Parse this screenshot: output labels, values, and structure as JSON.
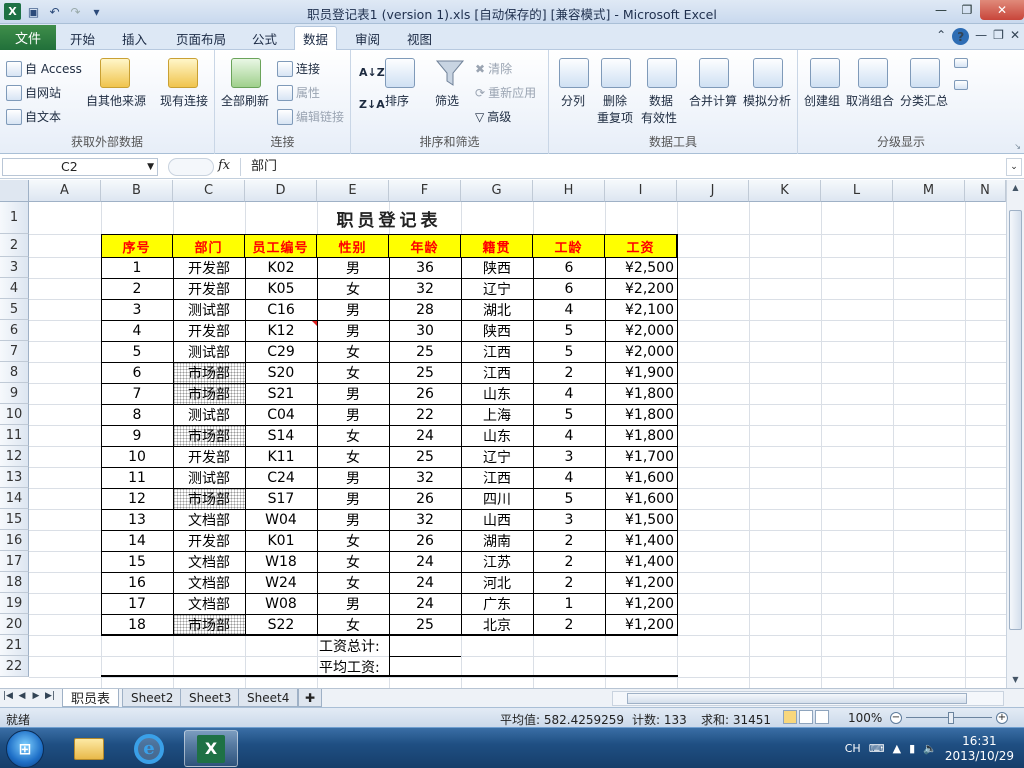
{
  "window": {
    "title": "职员登记表1 (version 1).xls [自动保存的]  [兼容模式]  -  Microsoft Excel"
  },
  "qat": {
    "app_icon": "excel-icon",
    "save_icon": "save-icon",
    "undo_icon": "undo-icon",
    "redo_icon": "redo-icon"
  },
  "menu": {
    "file": "文件",
    "tabs": [
      "开始",
      "插入",
      "页面布局",
      "公式",
      "数据",
      "审阅",
      "视图"
    ],
    "active_tab": "数据"
  },
  "ribbon": {
    "external": {
      "label": "获取外部数据",
      "access": "自 Access",
      "web": "自网站",
      "text": "自文本",
      "other": "自其他来源",
      "existing": "现有连接"
    },
    "connections": {
      "label": "连接",
      "refresh": "全部刷新",
      "connect": "连接",
      "properties": "属性",
      "edit_links": "编辑链接"
    },
    "sortfilter": {
      "label": "排序和筛选",
      "sort": "排序",
      "filter": "筛选",
      "clear": "清除",
      "reapply": "重新应用",
      "advanced": "高级",
      "az": "A↓Z",
      "za": "Z↓A"
    },
    "datatools": {
      "label": "数据工具",
      "split": "分列",
      "remove_dup": "删除",
      "remove_dup2": "重复项",
      "validation": "数据",
      "validation2": "有效性",
      "consolidate": "合并计算",
      "whatif": "模拟分析"
    },
    "outline": {
      "label": "分级显示",
      "group": "创建组",
      "ungroup": "取消组合",
      "subtotal": "分类汇总"
    }
  },
  "formula_bar": {
    "name_box": "C2",
    "fx": "fx",
    "content": "部门"
  },
  "columns": [
    "A",
    "B",
    "C",
    "D",
    "E",
    "F",
    "G",
    "H",
    "I",
    "J",
    "K",
    "L",
    "M",
    "N"
  ],
  "rows": [
    "1",
    "2",
    "3",
    "4",
    "5",
    "6",
    "7",
    "8",
    "9",
    "10",
    "11",
    "12",
    "13",
    "14",
    "15",
    "16",
    "17",
    "18",
    "19",
    "20",
    "21",
    "22"
  ],
  "sheet": {
    "title": "职员登记表",
    "headers": [
      "序号",
      "部门",
      "员工编号",
      "性别",
      "年龄",
      "籍贯",
      "工龄",
      "工资"
    ],
    "records": [
      [
        "1",
        "开发部",
        "K02",
        "男",
        "36",
        "陕西",
        "6",
        "¥2,500"
      ],
      [
        "2",
        "开发部",
        "K05",
        "女",
        "32",
        "辽宁",
        "6",
        "¥2,200"
      ],
      [
        "3",
        "测试部",
        "C16",
        "男",
        "28",
        "湖北",
        "4",
        "¥2,100"
      ],
      [
        "4",
        "开发部",
        "K12",
        "男",
        "30",
        "陕西",
        "5",
        "¥2,000"
      ],
      [
        "5",
        "测试部",
        "C29",
        "女",
        "25",
        "江西",
        "5",
        "¥2,000"
      ],
      [
        "6",
        "市场部",
        "S20",
        "女",
        "25",
        "江西",
        "2",
        "¥1,900"
      ],
      [
        "7",
        "市场部",
        "S21",
        "男",
        "26",
        "山东",
        "4",
        "¥1,800"
      ],
      [
        "8",
        "测试部",
        "C04",
        "男",
        "22",
        "上海",
        "5",
        "¥1,800"
      ],
      [
        "9",
        "市场部",
        "S14",
        "女",
        "24",
        "山东",
        "4",
        "¥1,800"
      ],
      [
        "10",
        "开发部",
        "K11",
        "女",
        "25",
        "辽宁",
        "3",
        "¥1,700"
      ],
      [
        "11",
        "测试部",
        "C24",
        "男",
        "32",
        "江西",
        "4",
        "¥1,600"
      ],
      [
        "12",
        "市场部",
        "S17",
        "男",
        "26",
        "四川",
        "5",
        "¥1,600"
      ],
      [
        "13",
        "文档部",
        "W04",
        "男",
        "32",
        "山西",
        "3",
        "¥1,500"
      ],
      [
        "14",
        "开发部",
        "K01",
        "女",
        "26",
        "湖南",
        "2",
        "¥1,400"
      ],
      [
        "15",
        "文档部",
        "W18",
        "女",
        "24",
        "江苏",
        "2",
        "¥1,400"
      ],
      [
        "16",
        "文档部",
        "W24",
        "女",
        "24",
        "河北",
        "2",
        "¥1,200"
      ],
      [
        "17",
        "文档部",
        "W08",
        "男",
        "24",
        "广东",
        "1",
        "¥1,200"
      ],
      [
        "18",
        "市场部",
        "S22",
        "女",
        "25",
        "北京",
        "2",
        "¥1,200"
      ]
    ],
    "total_label": "工资总计:",
    "avg_label": "平均工资:",
    "hatched_dept": "市场部"
  },
  "sheet_tabs": [
    "职员表",
    "Sheet2",
    "Sheet3",
    "Sheet4"
  ],
  "active_sheet": "职员表",
  "status": {
    "ready": "就绪",
    "average": "平均值: 582.4259259",
    "count": "计数: 133",
    "sum": "求和: 31451",
    "zoom": "100%"
  },
  "taskbar": {
    "lang": "CH",
    "time": "16:31",
    "date": "2013/10/29"
  },
  "colors": {
    "header_fill": "#ffff00",
    "header_text": "#ff0000",
    "file_tab": "#2a7a3b"
  }
}
